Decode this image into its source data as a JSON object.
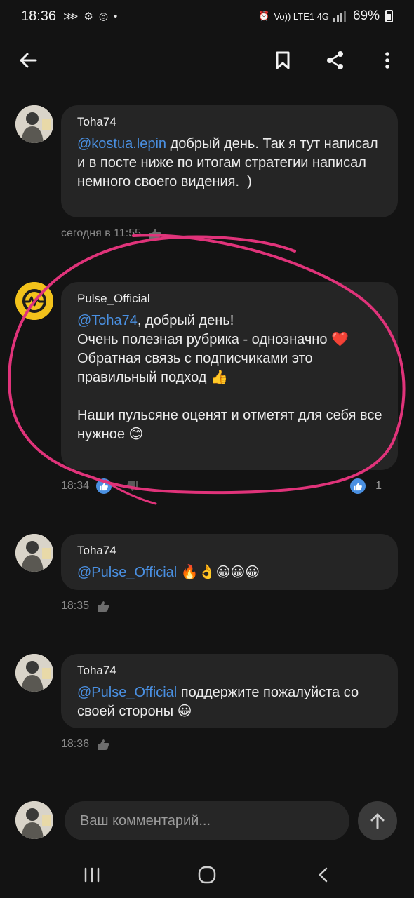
{
  "status_bar": {
    "time": "18:36",
    "battery": "69%",
    "network": "Vo)) LTE1 4G"
  },
  "toolbar": {
    "back_icon": "arrow-left",
    "bookmark_icon": "bookmark",
    "share_icon": "share",
    "menu_icon": "more-vertical"
  },
  "comments": [
    {
      "author": "Toha74",
      "mention": "@kostua.lepin",
      "text": " добрый день. Так я тут написал и в посте ниже по итогам стратегии написал немного своего видения.  )",
      "time": "сегодня в 11:55"
    },
    {
      "author": "Pulse_Official",
      "mention": "@Toha74",
      "text": ", добрый день!\nОчень полезная рубрика - однозначно ❤️\nОбратная связь с подписчиками это правильный подход 👍\n\nНаши пульсяне оценят и отметят для себя все нужное 😊",
      "time": "18:34",
      "likes": "1"
    },
    {
      "author": "Toha74",
      "mention": "@Pulse_Official",
      "text": " 🔥👌😀😀😀",
      "time": "18:35"
    },
    {
      "author": "Toha74",
      "mention": "@Pulse_Official",
      "text": " поддержите пожалуйста со своей стороны 😀",
      "time": "18:36"
    }
  ],
  "input": {
    "placeholder": "Ваш комментарий..."
  },
  "colors": {
    "background": "#131313",
    "bubble": "#252525",
    "mention": "#4a90e2",
    "annotation": "#e0337a",
    "pulse_logo": "#f2c21b"
  }
}
